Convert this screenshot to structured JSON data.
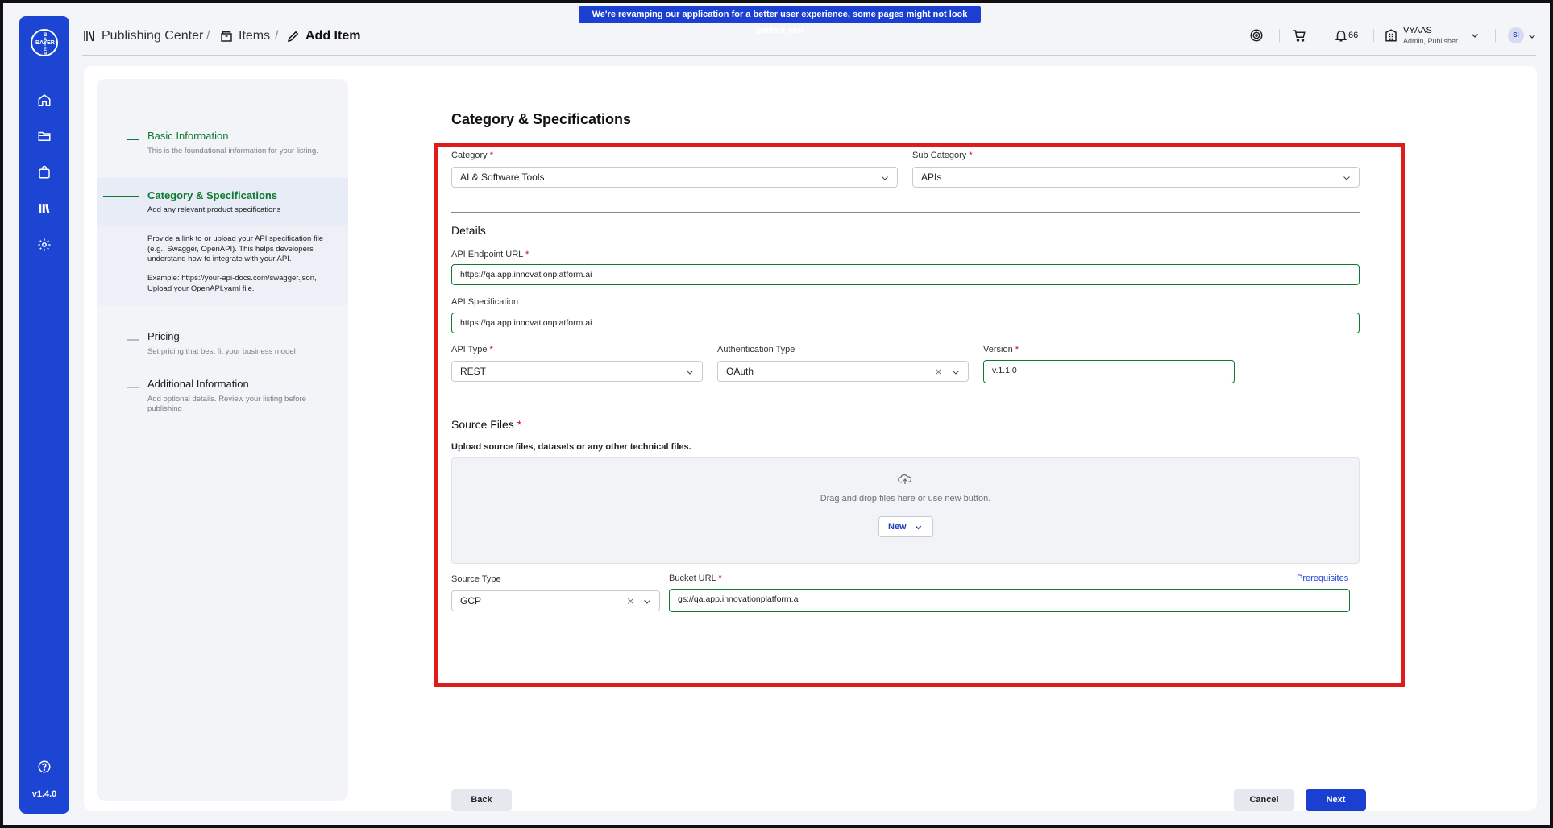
{
  "banner": "We're revamping our application for a better user experience, some pages might not look perfect yet!",
  "sidebar": {
    "logo_vertical": "BAYER",
    "logo_horizontal": "BAYER",
    "items": [
      {
        "icon": "home-icon"
      },
      {
        "icon": "folder-icon"
      },
      {
        "icon": "bag-icon"
      },
      {
        "icon": "publishing-icon"
      },
      {
        "icon": "gear-icon"
      }
    ],
    "help_icon": "help-icon",
    "version": "v1.4.0"
  },
  "breadcrumb": {
    "items": [
      {
        "label": "Publishing Center",
        "icon": "books-icon"
      },
      {
        "label": "Items",
        "icon": "box-icon"
      },
      {
        "label": "Add Item",
        "icon": "pencil-icon"
      }
    ],
    "separator": "/"
  },
  "header": {
    "notification_count": "66",
    "user_name": "VYAAS",
    "user_role": "Admin, Publisher",
    "avatar_initials": "SI"
  },
  "steps": [
    {
      "title": "Basic Information",
      "subtitle": "This is the foundational information for your listing.",
      "state": "done"
    },
    {
      "title": "Category & Specifications",
      "subtitle": "Add any relevant product specifications",
      "state": "current"
    },
    {
      "title": "Pricing",
      "subtitle": "Set pricing that best fit your business model",
      "state": "pending"
    },
    {
      "title": "Additional Information",
      "subtitle": "Add optional details. Review your listing before publishing",
      "state": "pending"
    }
  ],
  "help": {
    "paragraph1": "Provide a link to or upload your API specification file (e.g., Swagger, OpenAPI). This helps developers understand how to integrate with your API.",
    "paragraph2": "Example: https://your-api-docs.com/swagger.json, Upload your OpenAPI.yaml file."
  },
  "form": {
    "section_title": "Category & Specifications",
    "category": {
      "label": "Category",
      "value": "AI & Software Tools"
    },
    "sub_category": {
      "label": "Sub Category",
      "value": "APIs"
    },
    "details_title": "Details",
    "api_endpoint": {
      "label": "API Endpoint URL",
      "value": "https://qa.app.innovationplatform.ai"
    },
    "api_spec": {
      "label": "API Specification",
      "value": "https://qa.app.innovationplatform.ai"
    },
    "api_type": {
      "label": "API Type",
      "value": "REST"
    },
    "auth_type": {
      "label": "Authentication Type",
      "value": "OAuth"
    },
    "version": {
      "label": "Version",
      "value": "v.1.1.0"
    },
    "source_files_title": "Source Files",
    "source_files_desc": "Upload source files, datasets or any other technical files.",
    "dropzone_text": "Drag and drop files here or use new button.",
    "new_button": "New",
    "source_type": {
      "label": "Source Type",
      "value": "GCP"
    },
    "bucket_url": {
      "label": "Bucket URL",
      "value": "gs://qa.app.innovationplatform.ai"
    },
    "prerequisites_link": "Prerequisites",
    "required_mark": "*"
  },
  "footer": {
    "back": "Back",
    "cancel": "Cancel",
    "next": "Next"
  }
}
